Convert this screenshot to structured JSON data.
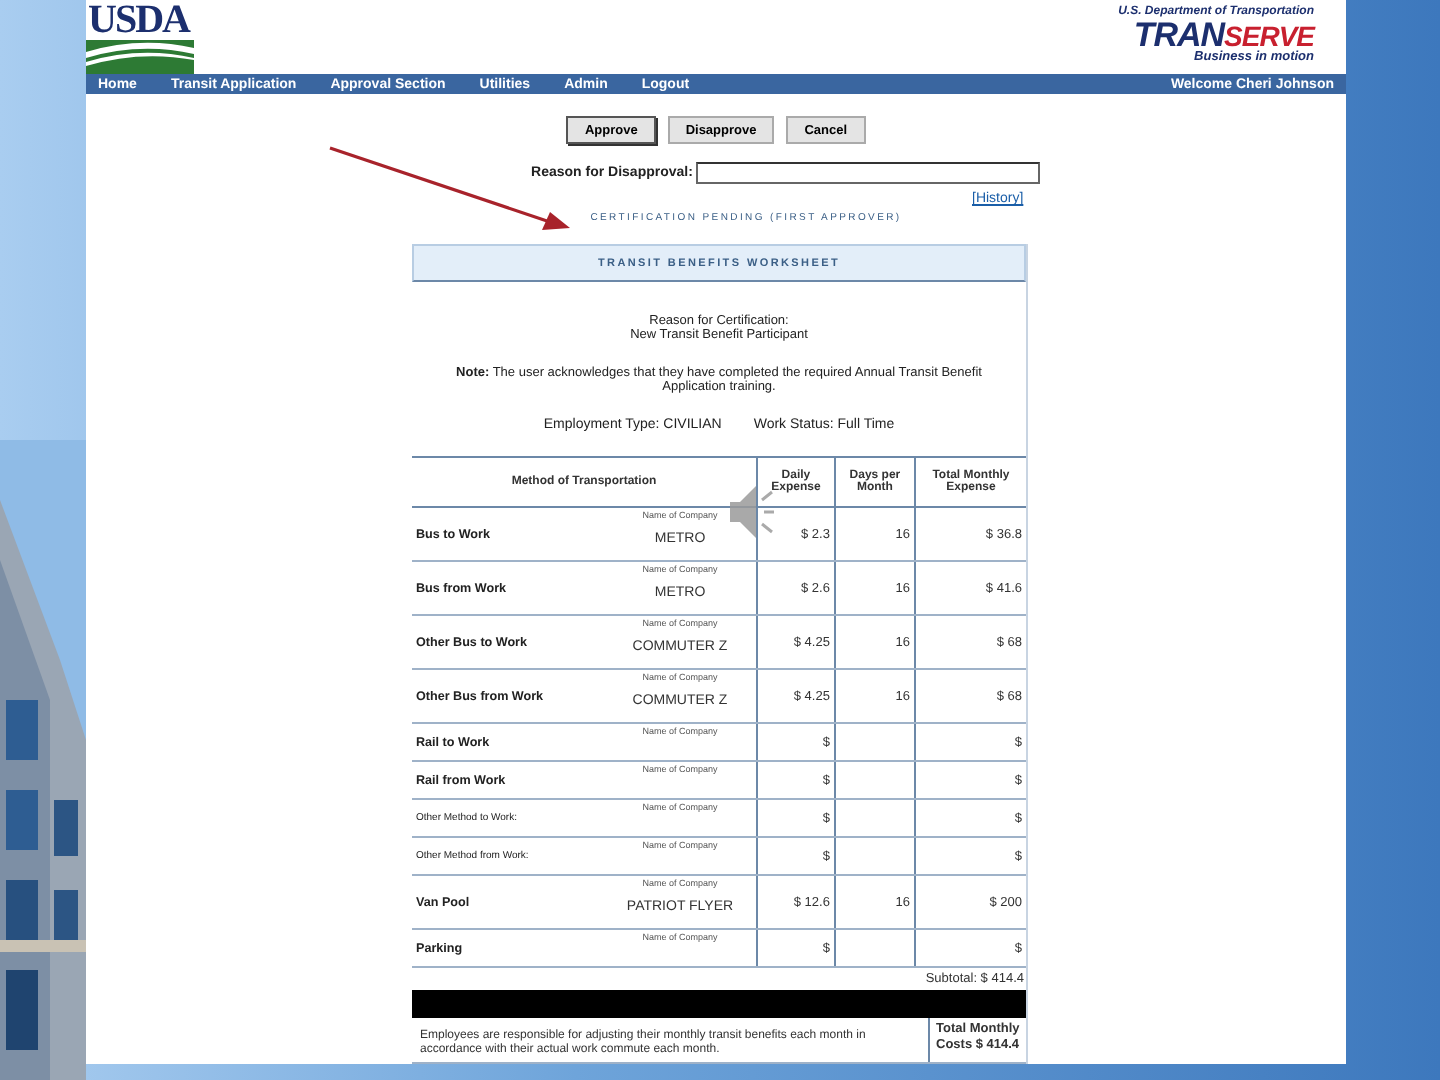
{
  "header": {
    "usda_logo": "USDA",
    "dot_line": "U.S. Department of Transportation",
    "brand_parts": [
      "TRAN",
      "SERVE"
    ],
    "tagline": "Business in motion"
  },
  "nav": {
    "items": [
      "Home",
      "Transit Application",
      "Approval Section",
      "Utilities",
      "Admin",
      "Logout"
    ],
    "welcome": "Welcome Cheri Johnson"
  },
  "actions": [
    "Approve",
    "Disapprove",
    "Cancel"
  ],
  "disapproval": {
    "label": "Reason for Disapproval:"
  },
  "history_link": "[History]",
  "status": "CERTIFICATION PENDING (FIRST APPROVER)",
  "worksheet": {
    "title": "TRANSIT BENEFITS WORKSHEET",
    "reason_label": "Reason for Certification:",
    "reason_value": "New Transit Benefit Participant",
    "note": "**Note:** The user acknowledges that they have completed the required Annual Transit Benefit Application training.",
    "employment_type": "Employment Type: CIVILIAN",
    "work_status": "Work Status: Full Time",
    "columns": [
      "Method of Transportation",
      "Daily Expense",
      "Days per Month",
      "Total Monthly Expense"
    ],
    "rows": [
      {
        "kind": "standard",
        "method": "Bus to Work",
        "company_label": "Name of Company",
        "company": "METRO",
        "daily": "$ 2.3",
        "days": "16",
        "total": "$ 36.8"
      },
      {
        "kind": "standard",
        "method": "Bus from Work",
        "company_label": "Name of Company",
        "company": "METRO",
        "daily": "$ 2.6",
        "days": "16",
        "total": "$ 41.6"
      },
      {
        "kind": "standard",
        "method": "Other Bus to Work",
        "company_label": "Name of Company",
        "company": "COMMUTER Z",
        "daily": "$ 4.25",
        "days": "16",
        "total": "$ 68"
      },
      {
        "kind": "standard",
        "method": "Other Bus from Work",
        "company_label": "Name of Company",
        "company": "COMMUTER Z",
        "daily": "$ 4.25",
        "days": "16",
        "total": "$ 68"
      },
      {
        "kind": "standard",
        "method": "Rail to Work",
        "company_label": "Name of Company",
        "daily": "$",
        "total": "$"
      },
      {
        "kind": "standard",
        "method": "Rail from Work",
        "company_label": "Name of Company",
        "daily": "$",
        "total": "$"
      },
      {
        "kind": "other",
        "method": "Other Method to Work:",
        "company_label": "Name of Company",
        "daily": "$",
        "total": "$"
      },
      {
        "kind": "other",
        "method": "Other Method from Work:",
        "company_label": "Name of Company",
        "daily": "$",
        "total": "$"
      },
      {
        "kind": "standard",
        "method": "Van Pool",
        "company_label": "Name of Company",
        "company": "PATRIOT FLYER",
        "daily": "$ 12.6",
        "days": "16",
        "total": "$ 200"
      },
      {
        "kind": "standard",
        "method": "Parking",
        "company_label": "Name of Company",
        "daily": "$",
        "total": "$"
      }
    ],
    "subtotal": "Subtotal: $ 414.4",
    "footer_text": "Employees are responsible for adjusting their monthly transit benefits each month in accordance with their actual work commute each month.",
    "total_costs": "Total Monthly Costs $ 414.4"
  }
}
